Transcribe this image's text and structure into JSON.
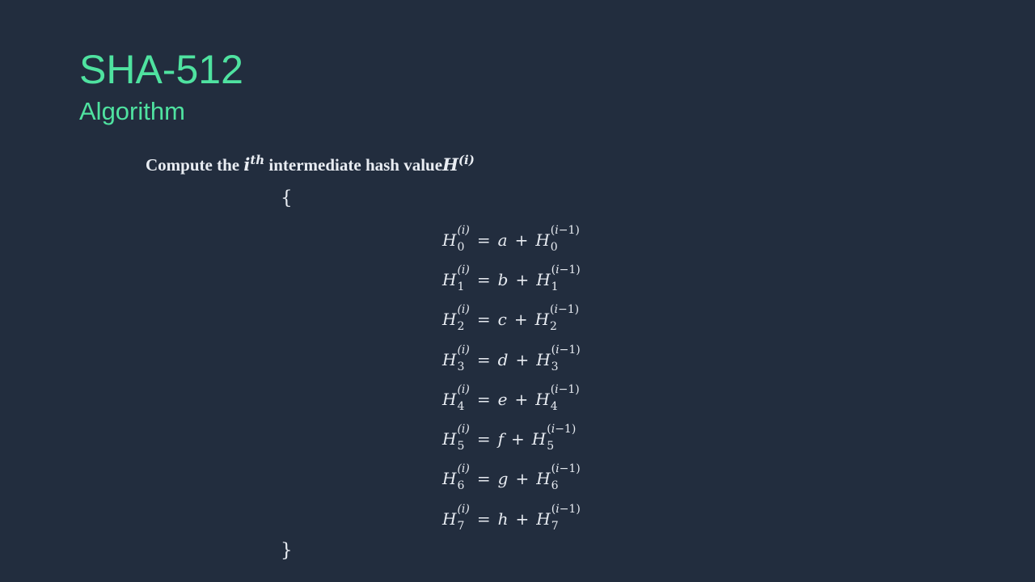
{
  "slide": {
    "title": "SHA-512",
    "subtitle": "Algorithm",
    "heading": {
      "part1": "Compute the",
      "i": "i",
      "th": "th",
      "part2": "intermediate hash value",
      "H": "H",
      "sup": "(i)"
    },
    "brace_open": "{",
    "brace_close": "}",
    "equations": [
      {
        "index": "0",
        "var": "a"
      },
      {
        "index": "1",
        "var": "b"
      },
      {
        "index": "2",
        "var": "c"
      },
      {
        "index": "3",
        "var": "d"
      },
      {
        "index": "4",
        "var": "e"
      },
      {
        "index": "5",
        "var": "f"
      },
      {
        "index": "6",
        "var": "g"
      },
      {
        "index": "7",
        "var": "h"
      }
    ],
    "eq_symbols": {
      "H": "H",
      "sup_i": "(i)",
      "sup_prev_open": "(",
      "sup_prev_i": "i",
      "sup_prev_rest": "−1)",
      "equals": "=",
      "plus": "+"
    }
  },
  "colors": {
    "background": "#222d3e",
    "accent": "#4fe2a0",
    "text": "#e8ecf2"
  }
}
